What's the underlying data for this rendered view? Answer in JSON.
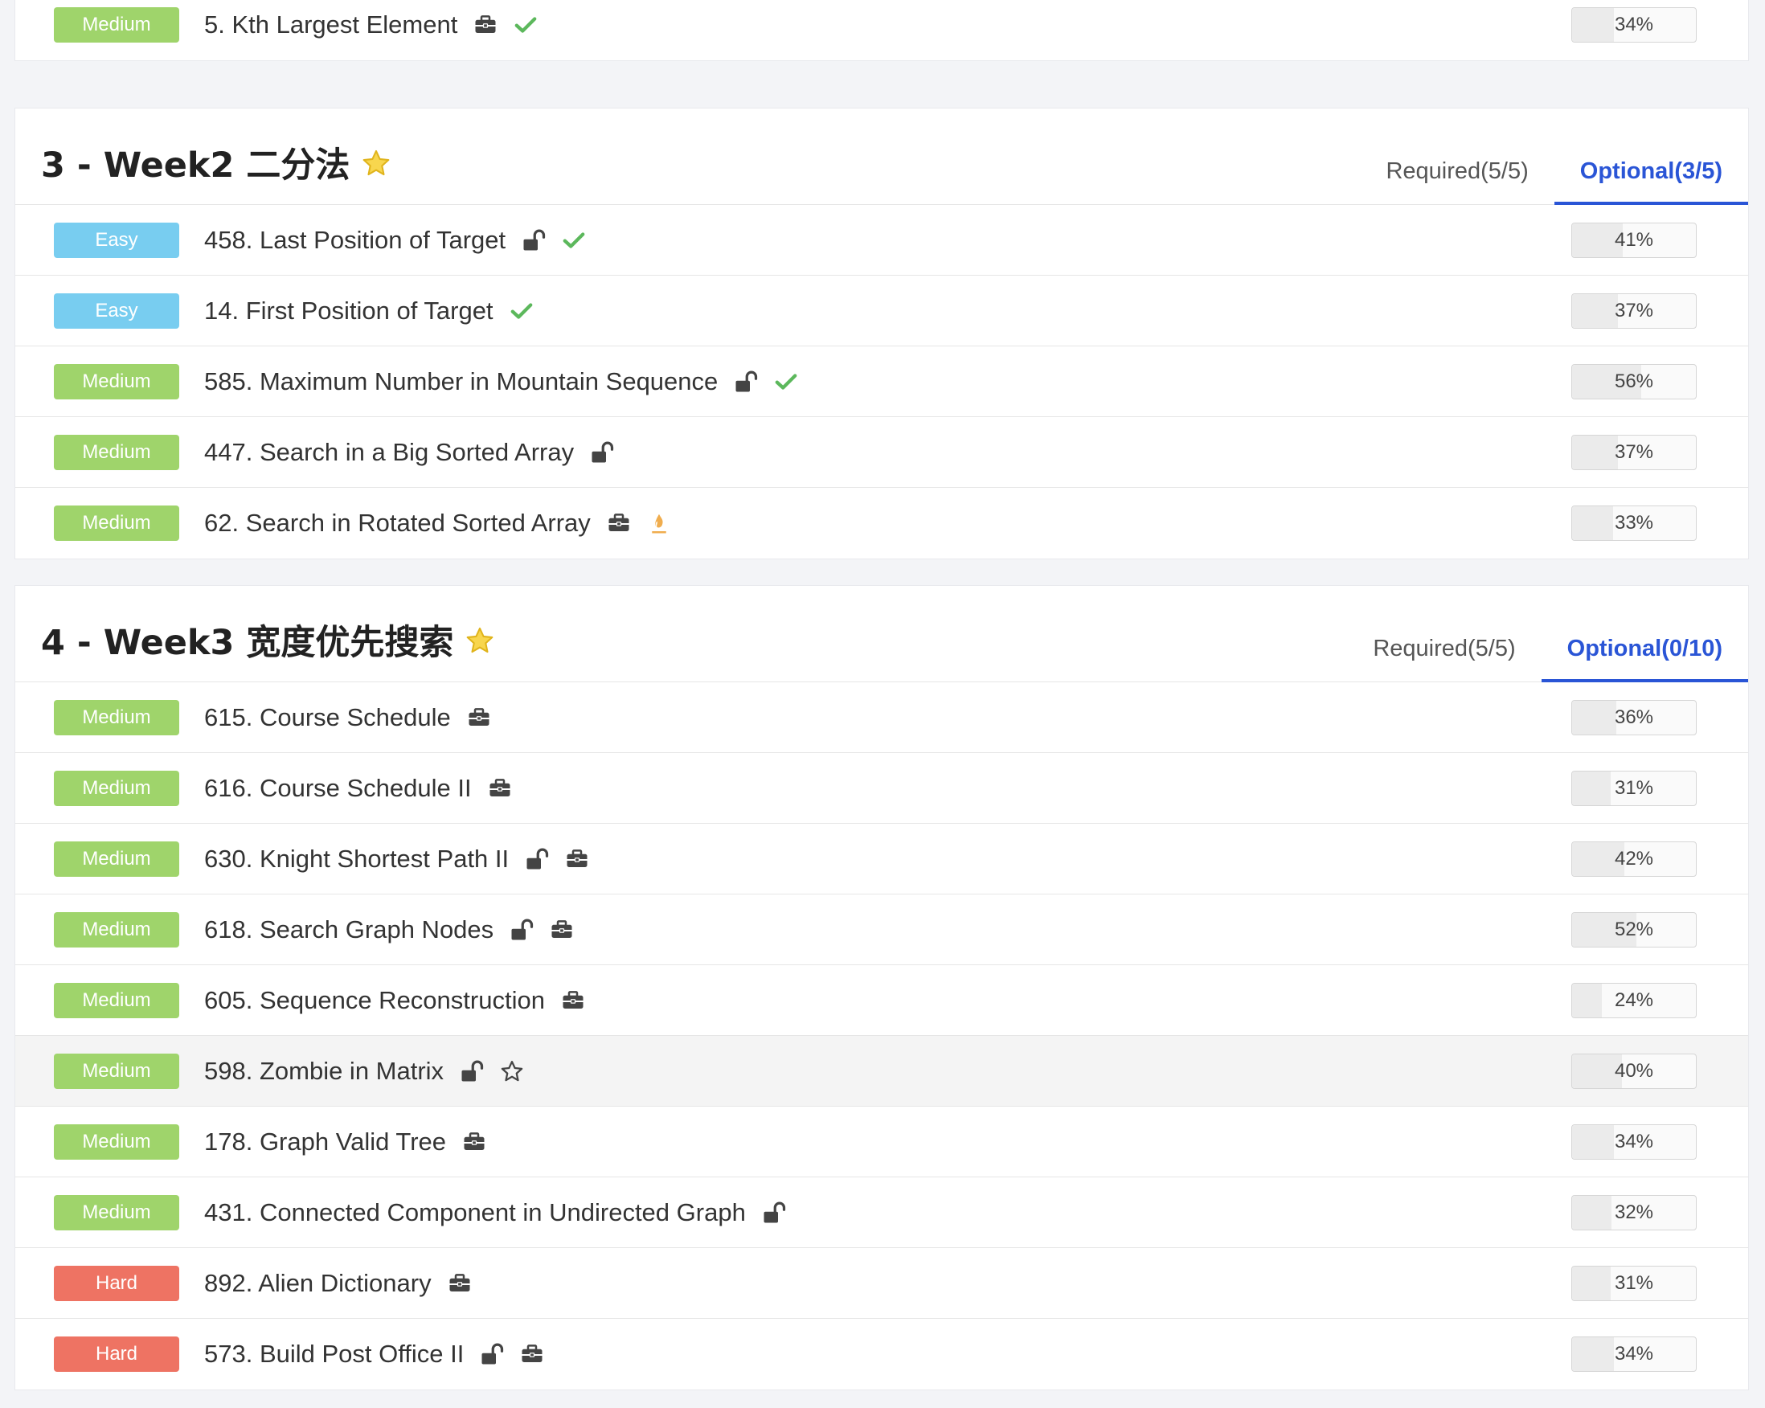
{
  "sections": [
    {
      "id": "section-week1-tail",
      "title": "",
      "has_header": false,
      "tabs": [],
      "rows": [
        {
          "difficulty": "Medium",
          "title": "5. Kth Largest Element",
          "icons": [
            "briefcase-icon",
            "check-icon"
          ],
          "acceptance": "34%",
          "acceptance_value": 0.34,
          "highlight": false
        }
      ]
    },
    {
      "id": "section-week2",
      "title": "3 - Week2 二分法",
      "has_header": true,
      "tabs": [
        {
          "label": "Required(5/5)",
          "active": false
        },
        {
          "label": "Optional(3/5)",
          "active": true
        }
      ],
      "rows": [
        {
          "difficulty": "Easy",
          "title": "458. Last Position of Target",
          "icons": [
            "unlock-icon",
            "check-icon"
          ],
          "acceptance": "41%",
          "acceptance_value": 0.41,
          "highlight": false
        },
        {
          "difficulty": "Easy",
          "title": "14. First Position of Target",
          "icons": [
            "check-icon"
          ],
          "acceptance": "37%",
          "acceptance_value": 0.37,
          "highlight": false
        },
        {
          "difficulty": "Medium",
          "title": "585. Maximum Number in Mountain Sequence",
          "icons": [
            "unlock-icon",
            "check-icon"
          ],
          "acceptance": "56%",
          "acceptance_value": 0.56,
          "highlight": false
        },
        {
          "difficulty": "Medium",
          "title": "447. Search in a Big Sorted Array",
          "icons": [
            "unlock-icon"
          ],
          "acceptance": "37%",
          "acceptance_value": 0.37,
          "highlight": false
        },
        {
          "difficulty": "Medium",
          "title": "62. Search in Rotated Sorted Array",
          "icons": [
            "briefcase-icon",
            "attempted-icon"
          ],
          "acceptance": "33%",
          "acceptance_value": 0.33,
          "highlight": false
        }
      ]
    },
    {
      "id": "section-week3",
      "title": "4 - Week3 宽度优先搜索",
      "has_header": true,
      "tabs": [
        {
          "label": "Required(5/5)",
          "active": false
        },
        {
          "label": "Optional(0/10)",
          "active": true
        }
      ],
      "rows": [
        {
          "difficulty": "Medium",
          "title": "615. Course Schedule",
          "icons": [
            "briefcase-icon"
          ],
          "acceptance": "36%",
          "acceptance_value": 0.36,
          "highlight": false
        },
        {
          "difficulty": "Medium",
          "title": "616. Course Schedule II",
          "icons": [
            "briefcase-icon"
          ],
          "acceptance": "31%",
          "acceptance_value": 0.31,
          "highlight": false
        },
        {
          "difficulty": "Medium",
          "title": "630. Knight Shortest Path II",
          "icons": [
            "unlock-icon",
            "briefcase-icon"
          ],
          "acceptance": "42%",
          "acceptance_value": 0.42,
          "highlight": false
        },
        {
          "difficulty": "Medium",
          "title": "618. Search Graph Nodes",
          "icons": [
            "unlock-icon",
            "briefcase-icon"
          ],
          "acceptance": "52%",
          "acceptance_value": 0.52,
          "highlight": false
        },
        {
          "difficulty": "Medium",
          "title": "605. Sequence Reconstruction",
          "icons": [
            "briefcase-icon"
          ],
          "acceptance": "24%",
          "acceptance_value": 0.24,
          "highlight": false
        },
        {
          "difficulty": "Medium",
          "title": "598. Zombie in Matrix",
          "icons": [
            "unlock-icon",
            "star-outline-icon"
          ],
          "acceptance": "40%",
          "acceptance_value": 0.4,
          "highlight": true
        },
        {
          "difficulty": "Medium",
          "title": "178. Graph Valid Tree",
          "icons": [
            "briefcase-icon"
          ],
          "acceptance": "34%",
          "acceptance_value": 0.34,
          "highlight": false
        },
        {
          "difficulty": "Medium",
          "title": "431. Connected Component in Undirected Graph",
          "icons": [
            "unlock-icon"
          ],
          "acceptance": "32%",
          "acceptance_value": 0.32,
          "highlight": false
        },
        {
          "difficulty": "Hard",
          "title": "892. Alien Dictionary",
          "icons": [
            "briefcase-icon"
          ],
          "acceptance": "31%",
          "acceptance_value": 0.31,
          "highlight": false
        },
        {
          "difficulty": "Hard",
          "title": "573. Build Post Office II",
          "icons": [
            "unlock-icon",
            "briefcase-icon"
          ],
          "acceptance": "34%",
          "acceptance_value": 0.34,
          "highlight": false
        }
      ]
    }
  ],
  "colors": {
    "easy": "#78cdf0",
    "medium": "#9fd46b",
    "hard": "#ee7363",
    "accent": "#2a55d6",
    "check": "#5cb85c",
    "star": "#f5c518",
    "attempted": "#f0ad4e"
  }
}
